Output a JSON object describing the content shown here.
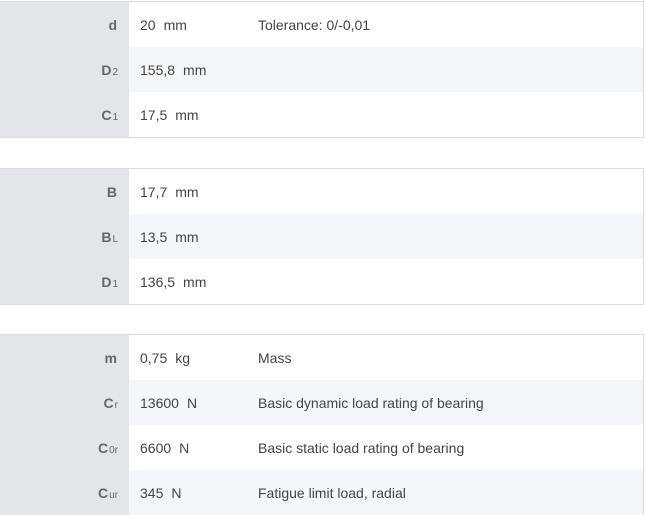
{
  "groups": [
    {
      "rows": [
        {
          "sym": "d",
          "sub": "",
          "value": "20",
          "unit": "mm",
          "desc": "Tolerance: 0/-0,01"
        },
        {
          "sym": "D",
          "sub": "2",
          "value": "155,8",
          "unit": "mm",
          "desc": ""
        },
        {
          "sym": "C",
          "sub": "1",
          "value": "17,5",
          "unit": "mm",
          "desc": ""
        }
      ]
    },
    {
      "rows": [
        {
          "sym": "B",
          "sub": "",
          "value": "17,7",
          "unit": "mm",
          "desc": ""
        },
        {
          "sym": "B",
          "sub": "L",
          "value": "13,5",
          "unit": "mm",
          "desc": ""
        },
        {
          "sym": "D",
          "sub": "1",
          "value": "136,5",
          "unit": "mm",
          "desc": ""
        }
      ]
    },
    {
      "rows": [
        {
          "sym": "m",
          "sub": "",
          "value": "0,75",
          "unit": "kg",
          "desc": "Mass"
        },
        {
          "sym": "C",
          "sub": "r",
          "value": "13600",
          "unit": "N",
          "desc": "Basic dynamic load rating of bearing"
        },
        {
          "sym": "C",
          "sub": "0r",
          "value": "6600",
          "unit": "N",
          "desc": "Basic static load rating of bearing"
        },
        {
          "sym": "C",
          "sub": "ur",
          "value": "345",
          "unit": "N",
          "desc": "Fatigue limit load, radial"
        }
      ]
    }
  ]
}
